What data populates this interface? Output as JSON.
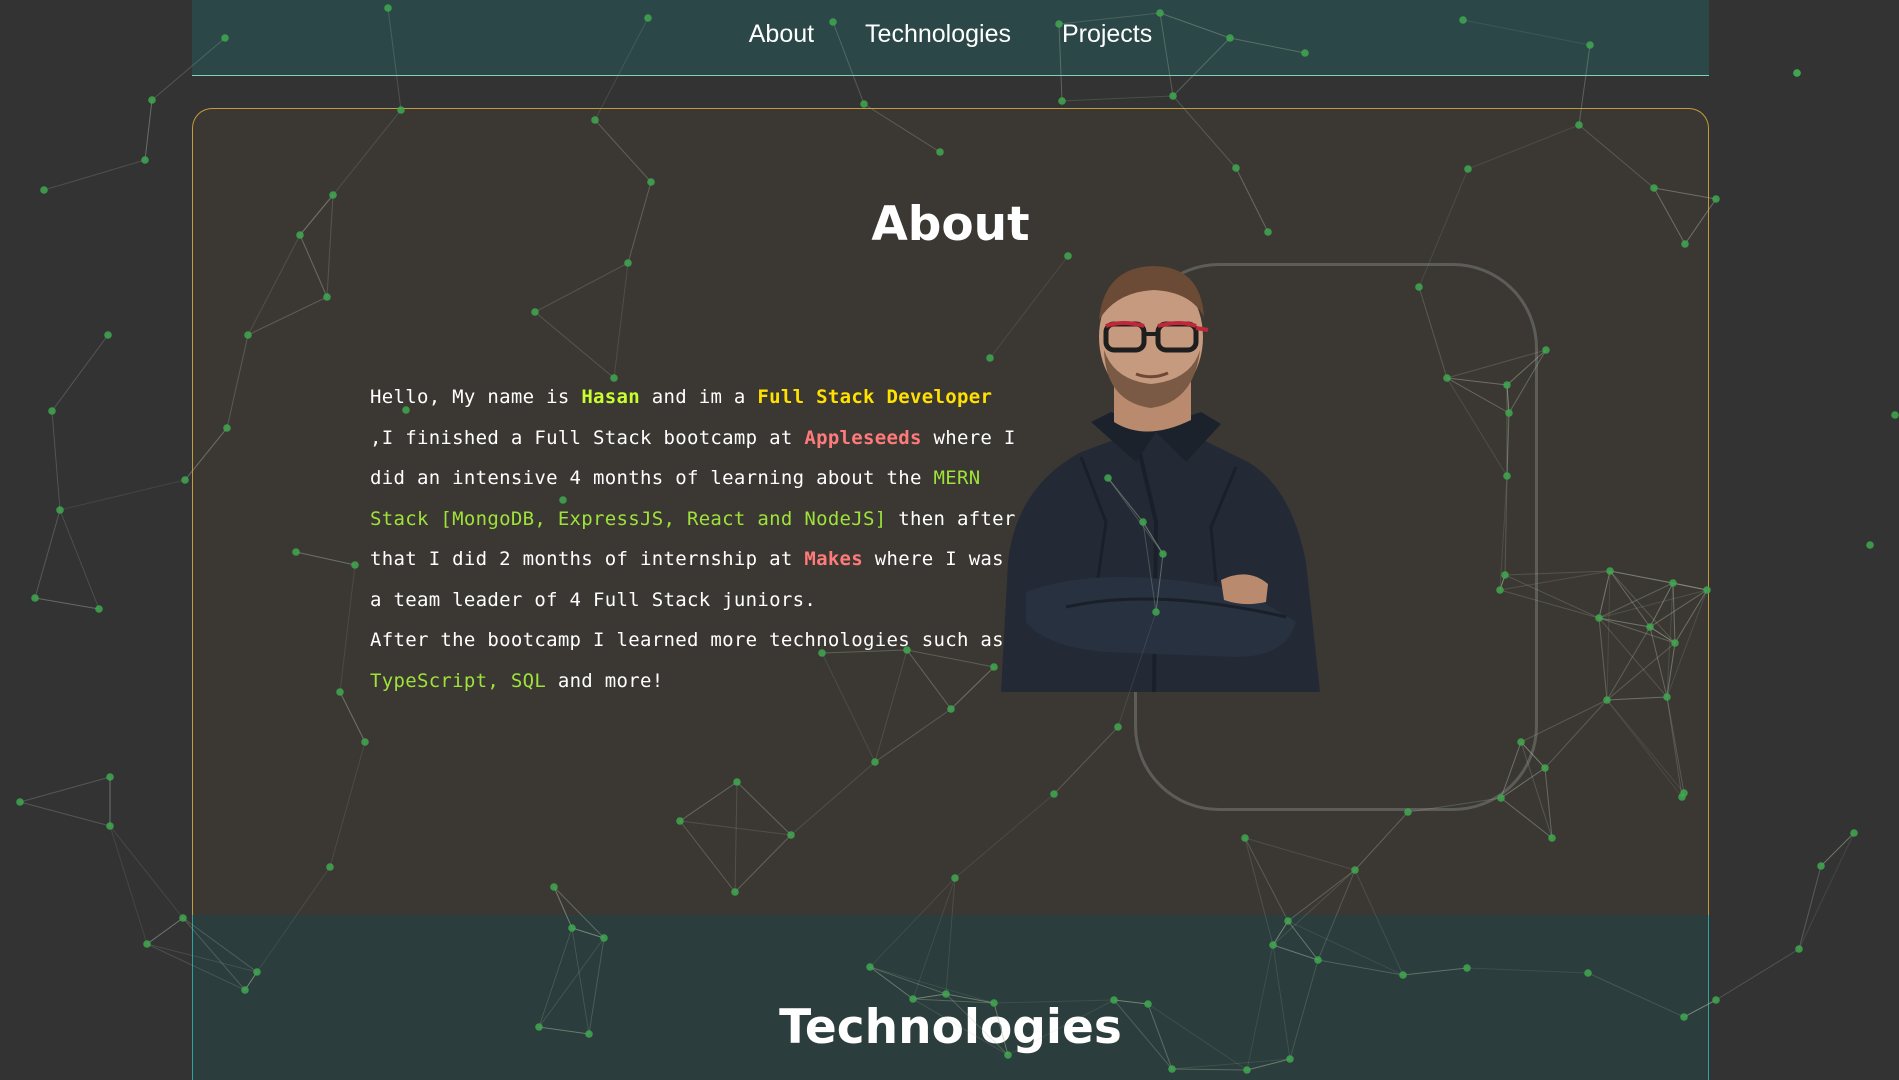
{
  "nav": {
    "items": [
      {
        "label": "About"
      },
      {
        "label": "Technologies"
      },
      {
        "label": "Projects"
      }
    ]
  },
  "about": {
    "title": "About",
    "bio": {
      "p1": "Hello, My name is ",
      "name": "Hasan",
      "p2": " and im a ",
      "role": "Full Stack Developer",
      "p3": " ,I finished a Full Stack bootcamp at ",
      "bootcamp": "Appleseeds",
      "p4": " where I did an intensive 4 months of learning about the ",
      "stack": "MERN Stack [MongoDB, ExpressJS, React and NodeJS]",
      "p5": " then after that I did 2 months of internship at ",
      "company": "Makes",
      "p6": " where I was a team leader of 4 Full Stack juniors.",
      "p7": "After the bootcamp I learned more technologies such as ",
      "more_tech": "TypeScript, SQL",
      "p8": " and more!"
    },
    "photo_icon": "person-portrait"
  },
  "technologies": {
    "title": "Technologies"
  },
  "colors": {
    "page_bg": "#333333",
    "navbar_bg": "#2b4747",
    "card_bg": "#3b3833",
    "card_border": "#c49a3a",
    "name_color": "#c8ff2e",
    "role_color": "#ffe100",
    "company_color": "#ff7a7a",
    "tech_color": "#9ee23a",
    "particle_node": "#3fa84f",
    "particle_line": "#a8b8a0"
  }
}
